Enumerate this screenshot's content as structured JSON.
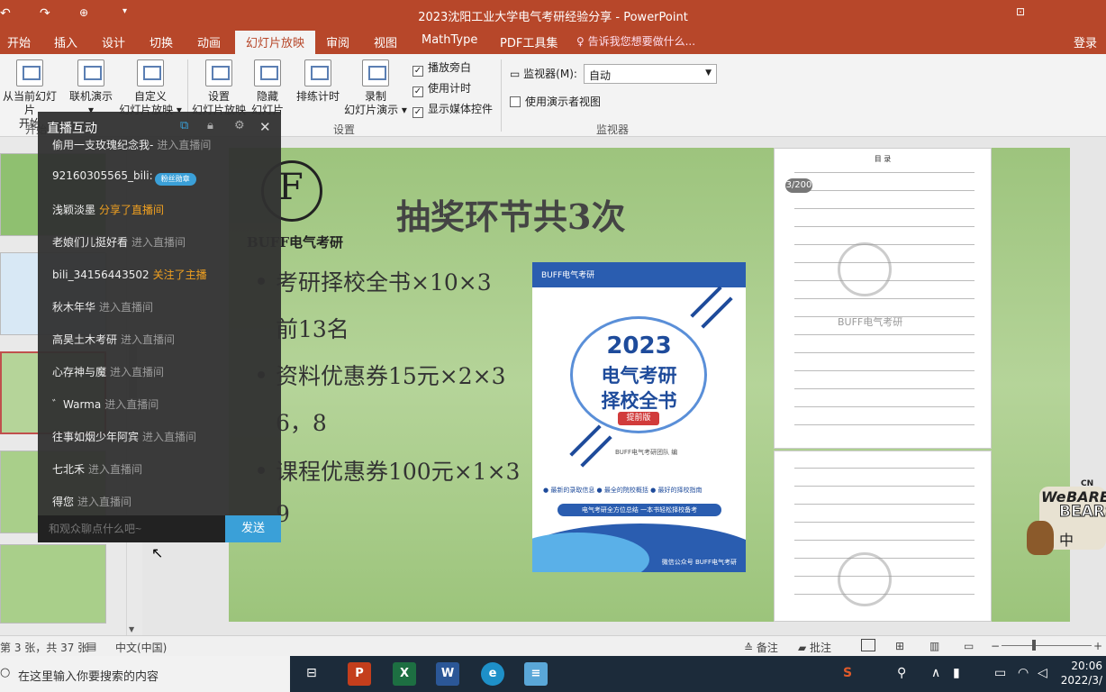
{
  "titlebar": {
    "undo": "↶",
    "redo": "↷",
    "start_icon": "slideshow-from-start-icon",
    "customize": "▾",
    "title": "2023沈阳工业大学电气考研经验分享 - PowerPoint",
    "restore": "⊡",
    "minimize": "—",
    "maximize": "☐",
    "close": "✕"
  },
  "tabs": [
    "开始",
    "插入",
    "设计",
    "切换",
    "动画",
    "幻灯片放映",
    "审阅",
    "视图",
    "MathType",
    "PDF工具集"
  ],
  "active_tab": "幻灯片放映",
  "tell_me": "告诉我您想要做什么...",
  "login": "登录",
  "ribbon": {
    "buttons": [
      {
        "line1": "从当前幻灯片",
        "line2": "开始"
      },
      {
        "line1": "联机演示",
        "line2": "▾"
      },
      {
        "line1": "自定义",
        "line2": "幻灯片放映 ▾"
      },
      {
        "line1": "设置",
        "line2": "幻灯片放映"
      },
      {
        "line1": "隐藏",
        "line2": "幻灯片"
      },
      {
        "line1": "排练计时",
        "line2": ""
      },
      {
        "line1": "录制",
        "line2": "幻灯片演示 ▾"
      }
    ],
    "checks": [
      {
        "label": "播放旁白",
        "checked": true
      },
      {
        "label": "使用计时",
        "checked": true
      },
      {
        "label": "显示媒体控件",
        "checked": true
      }
    ],
    "monitor_label": "监视器(M):",
    "monitor_value": "自动",
    "presenter_view": "使用演示者视图",
    "group_start": "开始",
    "group_setup": "设置",
    "group_monitor": "监视器"
  },
  "chat": {
    "title": "直播互动",
    "messages": [
      {
        "user": "偷用一支玫瑰纪念我-",
        "action": "进入直播间",
        "style": "grey"
      },
      {
        "user": "92160305565_bili:",
        "action": "",
        "style": "badge"
      },
      {
        "user": "浅颖淡墨",
        "action": "分享了直播间",
        "style": "orange"
      },
      {
        "user": "老娘们儿挺好看",
        "action": "进入直播间",
        "style": "grey"
      },
      {
        "user": "bili_34156443502",
        "action": "关注了主播",
        "style": "orange"
      },
      {
        "user": "秋木年华",
        "action": "进入直播间",
        "style": "grey"
      },
      {
        "user": "高昊土木考研",
        "action": "进入直播间",
        "style": "grey"
      },
      {
        "user": "心存神与魔",
        "action": "进入直播间",
        "style": "grey"
      },
      {
        "user": "゛Warma",
        "action": "进入直播间",
        "style": "grey"
      },
      {
        "user": "往事如烟少年阿宾",
        "action": "进入直播间",
        "style": "grey"
      },
      {
        "user": "七北禾",
        "action": "进入直播间",
        "style": "grey"
      },
      {
        "user": "得您",
        "action": "进入直播间",
        "style": "grey"
      }
    ],
    "badge_text": "粉丝勋章",
    "input_placeholder": "和观众聊点什么吧~",
    "send": "发送"
  },
  "slide": {
    "logo_letter": "F",
    "logo_text": "BUFF电气考研",
    "title": "抽奖环节共3次",
    "bullets": [
      {
        "text": "考研择校全书×10×3",
        "dot": true
      },
      {
        "text": "前13名",
        "dot": false
      },
      {
        "text": "资料优惠券15元×2×3",
        "dot": true
      },
      {
        "text": "6，8",
        "dot": false
      },
      {
        "text": "课程优惠券100元×1×3",
        "dot": true
      },
      {
        "text": "9",
        "dot": false
      }
    ],
    "book": {
      "brand": "BUFF电气考研",
      "year": "2023",
      "line1": "电气考研",
      "line2": "择校全书",
      "badge": "提前版",
      "publisher": "BUFF电气考研团队 编",
      "features": "● 最新的录取信息  ● 最全的院校概括  ● 最好的择校指南",
      "pill": "电气考研全方位总结  一本书轻松择校备考",
      "footer": "微信公众号 BUFF电气考研"
    },
    "doc_header": "目  录",
    "doc_watermark": "BUFF电气考研",
    "page_badge": "3/200"
  },
  "statusbar": {
    "slide_info": "第 3 张，共 37 张",
    "language": "中文(中国)",
    "notes": "备注",
    "comments": "批注",
    "zoom_minus": "−",
    "zoom_plus": "+"
  },
  "taskbar": {
    "search_placeholder": "在这里输入你要搜索的内容",
    "apps": [
      "P",
      "X",
      "W",
      "e",
      "≡"
    ],
    "time": "20:06",
    "date": "2022/3/"
  },
  "cartoon": {
    "cn": "CN",
    "we": "We",
    "bare": "BARE",
    "bears": "BEARS",
    "zh": "中"
  },
  "colors": {
    "accent": "#b7472a",
    "chat_send": "#3aa0d8",
    "slide_green": "#a8cc8a"
  }
}
